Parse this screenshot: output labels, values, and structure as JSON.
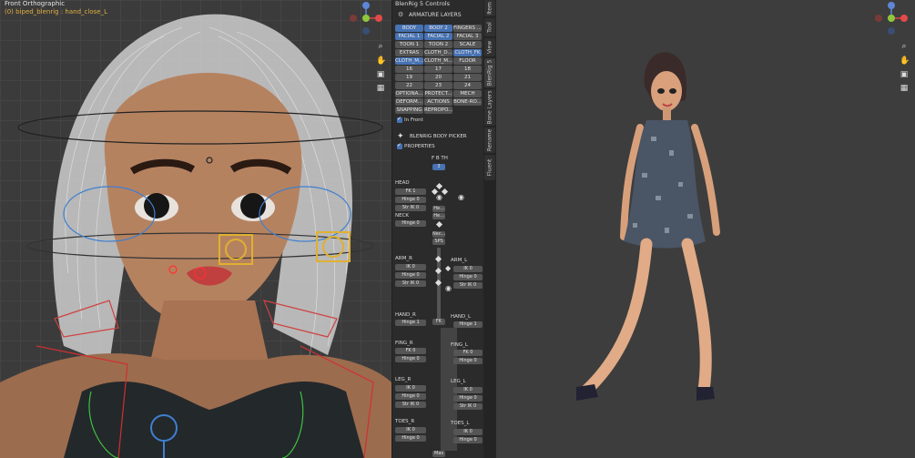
{
  "viewport_left": {
    "view_name": "Front Orthographic",
    "object_info": "(0) biped_blenrig : hand_close_L"
  },
  "panel": {
    "header": "BlenRig 5 Controls",
    "armature_layers_label": "ARMATURE LAYERS",
    "layers": [
      [
        "BODY",
        "BODY 2",
        "FINGERS ..."
      ],
      [
        "FACIAL 1",
        "FACIAL 2",
        "FACIAL 3"
      ],
      [
        "TOON 1",
        "TOON 2",
        "SCALE"
      ],
      [
        "EXTRAS",
        "CLOTH_D...",
        "CLOTH_FK"
      ],
      [
        "CLOTH_M...",
        "CLOTH_M...",
        "FLOOR"
      ],
      [
        "16",
        "17",
        "18"
      ],
      [
        "19",
        "20",
        "21"
      ],
      [
        "22",
        "23",
        "24"
      ],
      [
        "OPTIONA...",
        "PROTECT...",
        "MECH"
      ],
      [
        "DEFORM...",
        "ACTIONS",
        "BONE-RO..."
      ],
      [
        "SNAPPING",
        "REPROPO...",
        ""
      ]
    ],
    "in_front_label": "In Front",
    "body_picker_label": "BLENRIG BODY PICKER",
    "properties_label": "PROPERTIES",
    "fbth_label": "F B TH",
    "fbth_value": "3",
    "picker": {
      "head": "HEAD",
      "fk1": "FK 1",
      "hinge0": "Hinge 0",
      "strik0": "Str IK 0",
      "neck": "NECK",
      "neck_hinge": "Hinge 0",
      "arm_r": "ARM_R",
      "arm_l": "ARM_L",
      "ik0": "IK 0",
      "hinge": "Hinge 0",
      "str": "Str IK 0",
      "hand_r": "HAND_R",
      "hand_l": "HAND_L",
      "hinge1": "Hinge 1",
      "fing_r": "FING_R",
      "fing_l": "FING_L",
      "fk0": "FK 0",
      "leg_r": "LEG_R",
      "leg_l": "LEG_L",
      "toes_r": "TOES_R",
      "toes_l": "TOES_L",
      "he": "He...",
      "nec": "Nec...",
      "sps": "SPS",
      "fk": "FK",
      "ik": "IK",
      "mas": "Mas"
    }
  },
  "tabs": [
    "Item",
    "Tool",
    "View",
    "BlenRig 5",
    "Bone Layers",
    "Rename",
    "Fluent"
  ],
  "colors": {
    "active_blue": "#4772b3",
    "panel_bg": "#2b2b2b",
    "viewport_bg": "#3d3d3d"
  }
}
